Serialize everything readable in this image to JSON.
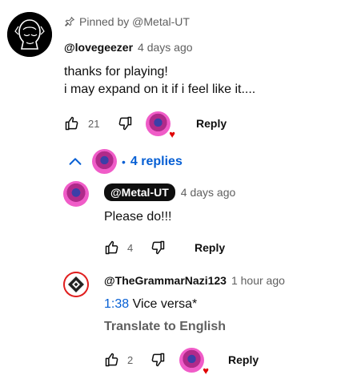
{
  "pinned": {
    "text": "Pinned by @Metal-UT"
  },
  "comment": {
    "author": "@lovegeezer",
    "time": "4 days ago",
    "lines": [
      "thanks for playing!",
      "i may expand on it if i feel like it...."
    ],
    "likes": "21",
    "reply_label": "Reply"
  },
  "replies_toggle": {
    "label": "4 replies",
    "separator": "•"
  },
  "reply1": {
    "author": "@Metal-UT",
    "time": "4 days ago",
    "text": "Please do!!!",
    "likes": "4",
    "reply_label": "Reply"
  },
  "reply2": {
    "author": "@TheGrammarNazi123",
    "time": "1 hour ago",
    "timestamp": "1:38",
    "text": " Vice versa*",
    "translate": "Translate to English",
    "likes": "2",
    "reply_label": "Reply"
  },
  "colors": {
    "accent": "#065fd4",
    "heart": "#e00000",
    "muted": "#606060"
  },
  "icons": [
    "pin-icon",
    "thumbs-up-icon",
    "thumbs-down-icon",
    "chevron-up-icon",
    "heart-icon"
  ]
}
